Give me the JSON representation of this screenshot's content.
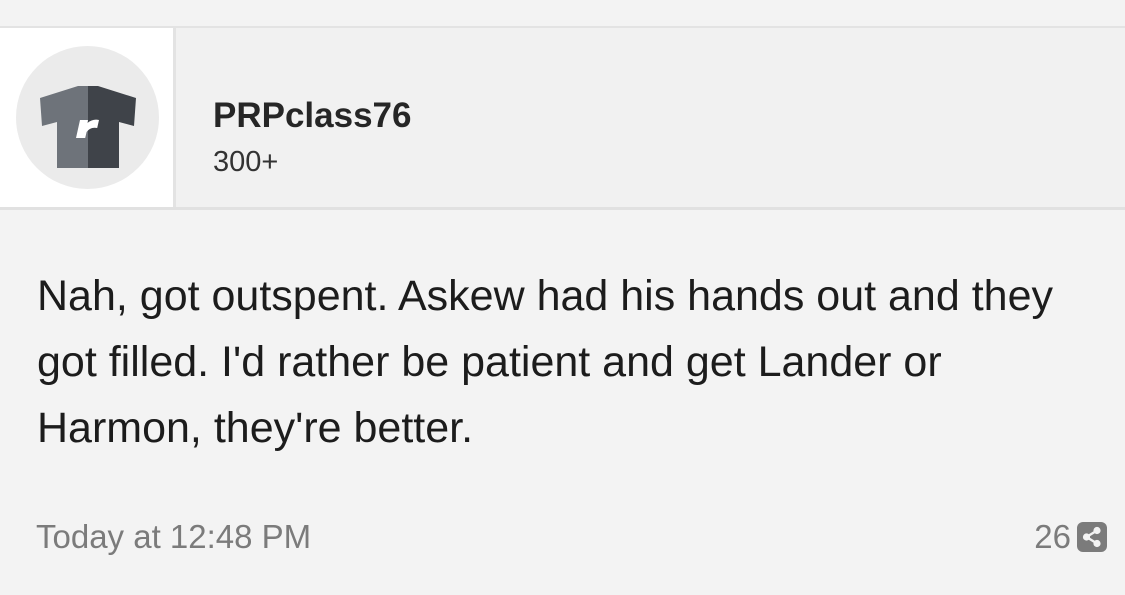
{
  "author": {
    "username": "PRPclass76",
    "count": "300+",
    "avatar_icon": "tshirt-r-logo-icon"
  },
  "post": {
    "body": "Nah, got outspent. Askew had his hands out and they got filled. I'd rather be patient and get Lander or Harmon, they're better.",
    "timestamp": "Today at 12:48 PM",
    "share_count": "26",
    "share_icon": "share-icon"
  },
  "colors": {
    "background": "#f3f3f3",
    "avatar_dark": "#3f4349",
    "avatar_light": "#6e737a",
    "muted_text": "#7b7b7b"
  }
}
